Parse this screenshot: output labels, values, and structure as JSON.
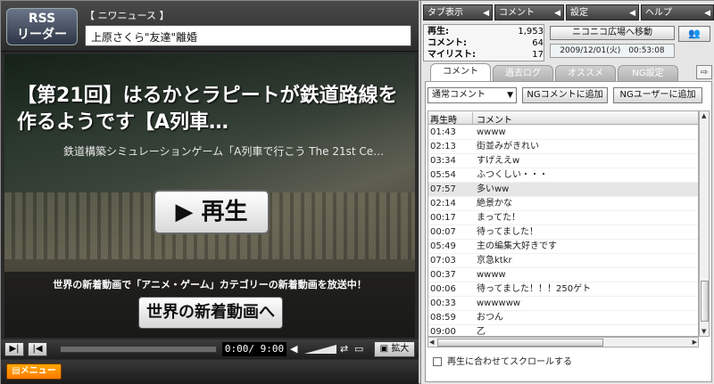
{
  "rss": {
    "logo_line1": "RSS",
    "logo_line2": "リーダー",
    "category": "【 ニワニュース 】",
    "headline": "上原さくら\"友達\"離婚"
  },
  "video": {
    "title": "【第21回】はるかとラピートが鉄道路線を作るようです【A列車…",
    "description": "鉄道構築シミュレーションゲーム「A列車で行こう The 21st Ce…",
    "play_label": "▶ 再生",
    "promo_text": "世界の新着動画で「アニメ・ゲーム」カテゴリーの新着動画を放送中！",
    "promo_button": "世界の新着動画へ"
  },
  "controls": {
    "time_current": "0:00",
    "time_total": "9:00",
    "time_separator": "/",
    "zoom_label": "拡大",
    "seek_progress": 0
  },
  "menu": {
    "menu_label": "メニュー"
  },
  "topmenu": [
    {
      "label": "タブ表示"
    },
    {
      "label": "コメント"
    },
    {
      "label": "設定"
    },
    {
      "label": "ヘルプ"
    }
  ],
  "stats": {
    "views_label": "再生:",
    "views_value": "1,953",
    "comments_label": "コメント:",
    "comments_value": "64",
    "mylist_label": "マイリスト:",
    "mylist_value": "17"
  },
  "plaza_button": "ニコニコ広場へ移動",
  "datetime": "2009/12/01(火)　00:53:08",
  "tabs": [
    {
      "label": "コメント",
      "active": true
    },
    {
      "label": "過去ログ"
    },
    {
      "label": "オススメ"
    },
    {
      "label": "NG設定"
    }
  ],
  "filter": {
    "selected": "通常コメント",
    "ng_comment_add": "NGコメントに追加",
    "ng_user_add": "NGユーザーに追加"
  },
  "table": {
    "col_time": "再生時",
    "col_comment": "コメント",
    "rows": [
      {
        "time": "01:43",
        "comment": "wwww"
      },
      {
        "time": "02:13",
        "comment": "街並みがきれい"
      },
      {
        "time": "03:34",
        "comment": "すげええw"
      },
      {
        "time": "05:54",
        "comment": "ふつくしい・・・"
      },
      {
        "time": "07:57",
        "comment": "多いww"
      },
      {
        "time": "02:14",
        "comment": "絶景かな"
      },
      {
        "time": "00:17",
        "comment": "まってた！"
      },
      {
        "time": "00:07",
        "comment": "待ってました！"
      },
      {
        "time": "05:49",
        "comment": "主の編集大好きです"
      },
      {
        "time": "07:03",
        "comment": "京急ktkr"
      },
      {
        "time": "00:37",
        "comment": "wwww"
      },
      {
        "time": "00:06",
        "comment": "待ってました！！！250ゲト"
      },
      {
        "time": "00:33",
        "comment": "wwwwww"
      },
      {
        "time": "08:59",
        "comment": "おつん"
      },
      {
        "time": "09:00",
        "comment": "乙"
      }
    ],
    "selected_row": 4
  },
  "sync_label": "再生に合わせてスクロールする",
  "colors": {
    "menu_orange": "#ff8a00",
    "panel_bg": "#e6e6e6"
  }
}
